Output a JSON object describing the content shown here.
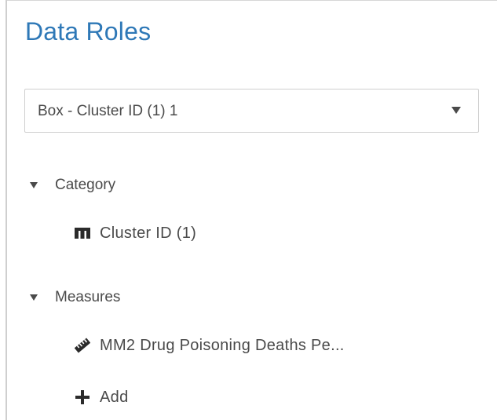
{
  "panel": {
    "title": "Data Roles"
  },
  "object_select": {
    "value": "Box - Cluster ID (1) 1",
    "icon": "chevron-down-icon"
  },
  "sections": {
    "category": {
      "label": "Category",
      "items": [
        {
          "label": "Cluster ID (1)",
          "icon": "category-icon"
        }
      ]
    },
    "measures": {
      "label": "Measures",
      "items": [
        {
          "label": "MM2 Drug Poisoning Deaths Pe...",
          "icon": "measure-ruler-icon"
        }
      ],
      "add_label": "Add"
    }
  },
  "colors": {
    "title": "#2e78b7",
    "text": "#4a4a4a",
    "border": "#cfcfcf"
  }
}
